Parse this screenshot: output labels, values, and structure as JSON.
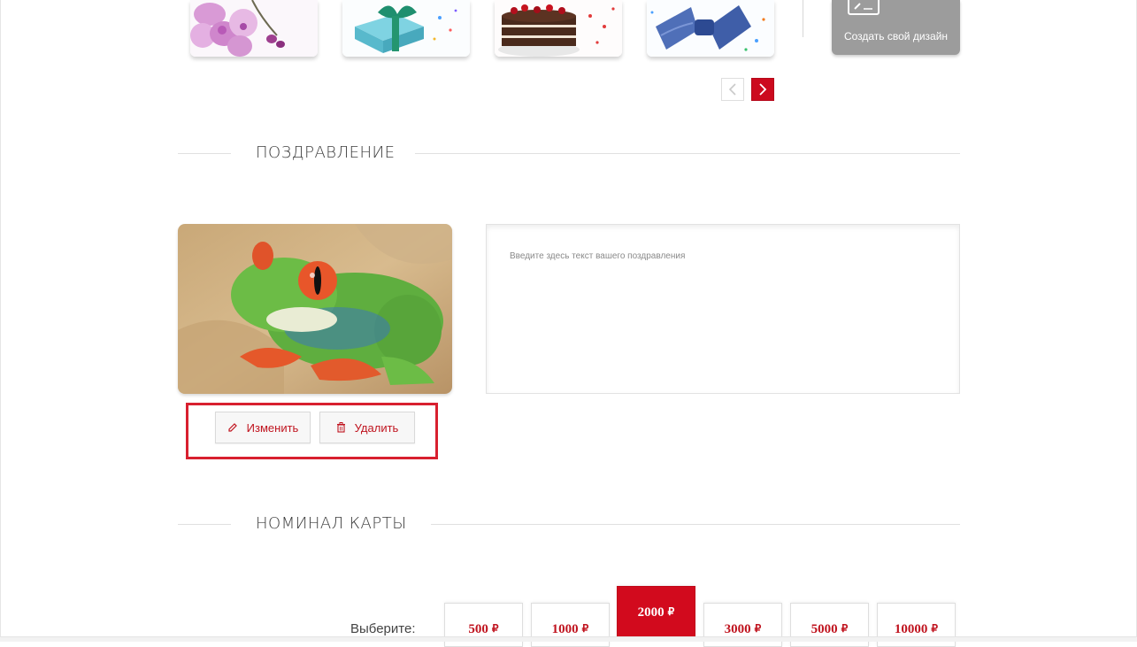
{
  "custom_design": {
    "label": "Создать свой дизайн"
  },
  "design_tiles": [
    "orchids",
    "gift-box",
    "cake",
    "bow-tie"
  ],
  "sections": {
    "greeting_title": "ПОЗДРАВЛЕНИЕ",
    "denomination_title": "НОМИНАЛ КАРТЫ"
  },
  "photo_actions": {
    "edit_label": "Изменить",
    "delete_label": "Удалить"
  },
  "greeting": {
    "placeholder": "Введите здесь текст вашего поздравления",
    "value": ""
  },
  "denomination": {
    "choose_label": "Выберите:",
    "currency": "₽",
    "options": [
      "500",
      "1000",
      "2000",
      "3000",
      "5000",
      "10000"
    ],
    "selected": "2000"
  },
  "colors": {
    "accent": "#d20a1d",
    "muted_tile": "#9c9c9c"
  }
}
